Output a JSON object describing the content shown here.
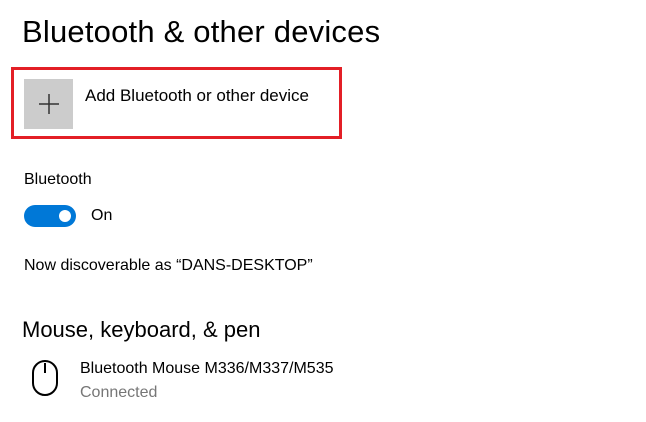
{
  "page": {
    "title": "Bluetooth & other devices"
  },
  "add_device": {
    "label": "Add Bluetooth or other device",
    "icon": "plus-icon"
  },
  "bluetooth": {
    "label": "Bluetooth",
    "toggle_state": "On",
    "enabled": true,
    "accent_color": "#0078d7"
  },
  "discoverable": {
    "text": "Now discoverable as “DANS-DESKTOP”"
  },
  "mouse_section": {
    "title": "Mouse, keyboard, & pen",
    "devices": [
      {
        "name": "Bluetooth Mouse M336/M337/M535",
        "status": "Connected",
        "icon": "mouse-icon"
      }
    ]
  },
  "highlight_color": "#e31f26"
}
